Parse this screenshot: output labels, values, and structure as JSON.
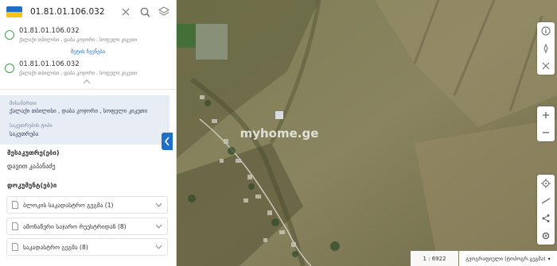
{
  "search": {
    "value": "01.81.01.106.032"
  },
  "results": [
    {
      "code": "01.81.01.106.032",
      "address": "ქალაქი თბილისი , დაბა კოჯორი , სოფელი კიკეთი"
    },
    {
      "code": "01.81.01.106.032",
      "address": "ქალაქი თბილისი , დაბა კოჯორი , სოფელი კიკეთი"
    }
  ],
  "results_more_label": "მეტის ჩვენება",
  "info": {
    "address_label": "მისამართი",
    "address_value": "ქალაქი თბილისი , დაბა კოჯორი , სოფელი კიკეთი",
    "ownership_label": "საკუთრების ტიპი",
    "ownership_value": "საკუთრება"
  },
  "owner_section": {
    "title": "მესაკუთრე(ები)",
    "value": "დავით კაპანაძე"
  },
  "docs_section": {
    "title": "დოკუმენტ(ებ)ი"
  },
  "accordions": [
    {
      "label": "ბლოკის საკადასტრო გეგმა (1)"
    },
    {
      "label": "ამონაწერი საჯარო რეესტრიდან (8)"
    },
    {
      "label": "საკადასტრო გეგმა (8)"
    }
  ],
  "map": {
    "watermark": "myhome.ge",
    "scale": "1 : 6922",
    "layer": "გეოგრაფიული (ტოპოგრ.გეგმა)"
  },
  "colors": {
    "brand_blue": "#1e6fc7",
    "brand_yellow": "#f6c21c",
    "result_circle": "#3aa34a",
    "info_bg": "#e8edf5"
  },
  "icons": [
    "close-icon",
    "search-icon",
    "layers-icon",
    "chevron-up-icon",
    "chevron-left-icon",
    "document-icon",
    "chevron-down-icon",
    "info-icon",
    "compass-icon",
    "measure-icon",
    "zoom-in-icon",
    "zoom-out-icon",
    "locate-icon",
    "ruler-icon",
    "share-icon",
    "settings-icon"
  ]
}
